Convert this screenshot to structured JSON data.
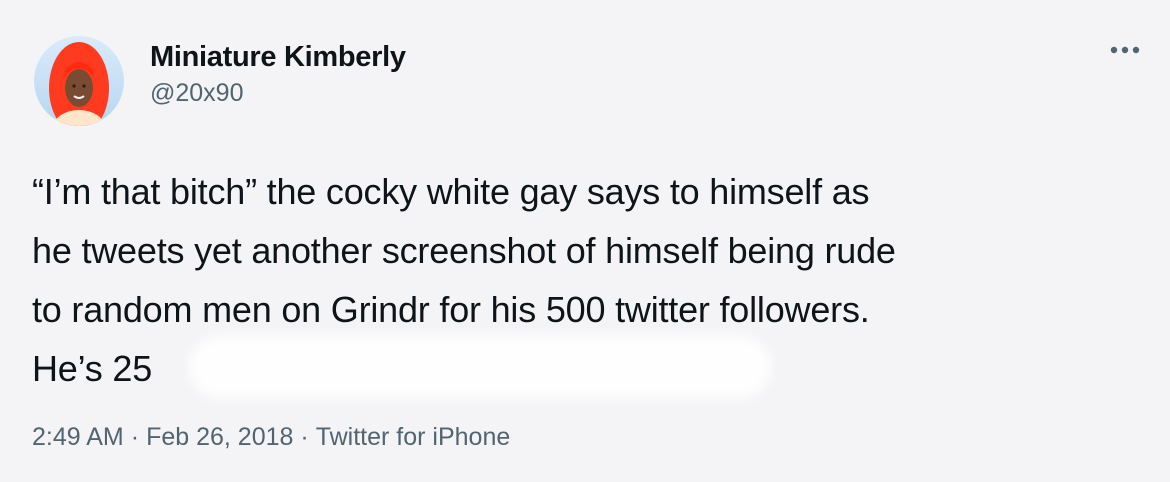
{
  "author": {
    "display_name": "Miniature Kimberly",
    "handle": "@20x90",
    "avatar_icon": "profile-avatar"
  },
  "menu": {
    "icon": "more-options-icon"
  },
  "tweet": {
    "text": "“I’m that bitch” the cocky white gay says to himself as\nhe tweets yet another screenshot of himself being rude\nto random men on Grindr for his 500 twitter followers.\nHe’s 25",
    "time": "2:49 AM",
    "separator": "·",
    "date": "Feb 26, 2018",
    "source": "Twitter for iPhone"
  },
  "colors": {
    "background": "#f4f4f6",
    "text": "#0f1419",
    "secondary": "#536471",
    "avatar_hair": "#ff3b1f"
  }
}
